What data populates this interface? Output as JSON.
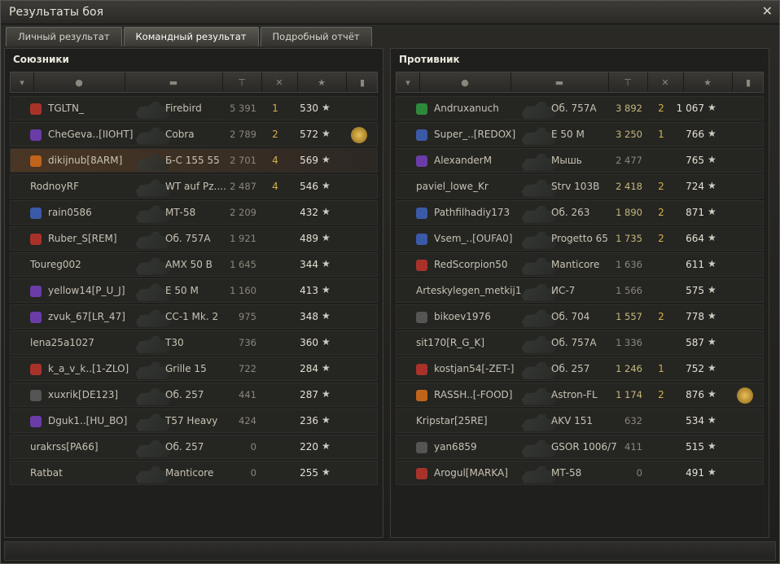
{
  "window": {
    "title": "Результаты боя"
  },
  "tabs": [
    {
      "label": "Личный результат",
      "active": false
    },
    {
      "label": "Командный результат",
      "active": true
    },
    {
      "label": "Подробный отчёт",
      "active": false
    }
  ],
  "allies": {
    "title": "Союзники",
    "rows": [
      {
        "name": "TGLTN_",
        "badge": "red",
        "tank": "Firebird",
        "damage": "5 391",
        "frags": "1",
        "xp": "530",
        "medal": false,
        "highlight": false
      },
      {
        "name": "CheGeva..[IIOHT]",
        "badge": "purple",
        "tank": "Cobra",
        "damage": "2 789",
        "frags": "2",
        "xp": "572",
        "medal": true,
        "highlight": false
      },
      {
        "name": "dikijnub[8ARM]",
        "badge": "orange",
        "tank": "Б-С 155 55",
        "damage": "2 701",
        "frags": "4",
        "xp": "569",
        "medal": false,
        "highlight": true
      },
      {
        "name": "RodnoyRF",
        "badge": "",
        "tank": "WT auf Pz....",
        "damage": "2 487",
        "frags": "4",
        "xp": "546",
        "medal": false,
        "highlight": false
      },
      {
        "name": "rain0586",
        "badge": "blue",
        "tank": "МТ-58",
        "damage": "2 209",
        "frags": "",
        "xp": "432",
        "medal": false,
        "highlight": false
      },
      {
        "name": "Ruber_S[REM]",
        "badge": "red",
        "tank": "Об. 757А",
        "damage": "1 921",
        "frags": "",
        "xp": "489",
        "medal": false,
        "highlight": false
      },
      {
        "name": "Toureg002",
        "badge": "",
        "tank": "AMX 50 B",
        "damage": "1 645",
        "frags": "",
        "xp": "344",
        "medal": false,
        "highlight": false
      },
      {
        "name": "yellow14[P_U_J]",
        "badge": "purple",
        "tank": "E 50 M",
        "damage": "1 160",
        "frags": "",
        "xp": "413",
        "medal": false,
        "highlight": false
      },
      {
        "name": "zvuk_67[LR_47]",
        "badge": "purple",
        "tank": "CC-1 Mk. 2",
        "damage": "975",
        "frags": "",
        "xp": "348",
        "medal": false,
        "highlight": false
      },
      {
        "name": "lena25a1027",
        "badge": "",
        "tank": "T30",
        "damage": "736",
        "frags": "",
        "xp": "360",
        "medal": false,
        "highlight": false
      },
      {
        "name": "k_a_v_k..[1-ZLO]",
        "badge": "red",
        "tank": "Grille 15",
        "damage": "722",
        "frags": "",
        "xp": "284",
        "medal": false,
        "highlight": false
      },
      {
        "name": "xuxrik[DE123]",
        "badge": "gray",
        "tank": "Об. 257",
        "damage": "441",
        "frags": "",
        "xp": "287",
        "medal": false,
        "highlight": false
      },
      {
        "name": "Dguk1..[HU_BO]",
        "badge": "purple",
        "tank": "T57 Heavy",
        "damage": "424",
        "frags": "",
        "xp": "236",
        "medal": false,
        "highlight": false
      },
      {
        "name": "urakrss[PA66]",
        "badge": "",
        "tank": "Об. 257",
        "damage": "0",
        "frags": "",
        "xp": "220",
        "medal": false,
        "highlight": false
      },
      {
        "name": "Ratbat",
        "badge": "",
        "tank": "Manticore",
        "damage": "0",
        "frags": "",
        "xp": "255",
        "medal": false,
        "highlight": false
      }
    ]
  },
  "enemies": {
    "title": "Противник",
    "rows": [
      {
        "name": "Andruxanuch",
        "badge": "green",
        "tank": "Об. 757А",
        "damage": "3 892",
        "frags": "2",
        "xp": "1 067",
        "medal": false
      },
      {
        "name": "Super_..[REDOX]",
        "badge": "blue",
        "tank": "E 50 M",
        "damage": "3 250",
        "frags": "1",
        "xp": "766",
        "medal": false
      },
      {
        "name": "AlexanderM",
        "badge": "purple",
        "tank": "Мышь",
        "damage": "2 477",
        "frags": "",
        "xp": "765",
        "medal": false
      },
      {
        "name": "paviel_lowe_Kr",
        "badge": "",
        "tank": "Strv 103B",
        "damage": "2 418",
        "frags": "2",
        "xp": "724",
        "medal": false
      },
      {
        "name": "Pathfilhadiy173",
        "badge": "blue",
        "tank": "Об. 263",
        "damage": "1 890",
        "frags": "2",
        "xp": "871",
        "medal": false
      },
      {
        "name": "Vsem_..[OUFA0]",
        "badge": "blue",
        "tank": "Progetto 65",
        "damage": "1 735",
        "frags": "2",
        "xp": "664",
        "medal": false
      },
      {
        "name": "RedScorpion50",
        "badge": "red",
        "tank": "Manticore",
        "damage": "1 636",
        "frags": "",
        "xp": "611",
        "medal": false
      },
      {
        "name": "Arteskylegen_metkij1",
        "badge": "",
        "tank": "ИС-7",
        "damage": "1 566",
        "frags": "",
        "xp": "575",
        "medal": false
      },
      {
        "name": "bikoev1976",
        "badge": "gray",
        "tank": "Об. 704",
        "damage": "1 557",
        "frags": "2",
        "xp": "778",
        "medal": false
      },
      {
        "name": "sit170[R_G_K]",
        "badge": "",
        "tank": "Об. 757А",
        "damage": "1 336",
        "frags": "",
        "xp": "587",
        "medal": false
      },
      {
        "name": "kostjan54[-ZET-]",
        "badge": "red",
        "tank": "Об. 257",
        "damage": "1 246",
        "frags": "1",
        "xp": "752",
        "medal": false
      },
      {
        "name": "RASSH..[-FOOD]",
        "badge": "orange",
        "tank": "Astron-FL",
        "damage": "1 174",
        "frags": "2",
        "xp": "876",
        "medal": true
      },
      {
        "name": "Kripstar[25RE]",
        "badge": "",
        "tank": "AKV 151",
        "damage": "632",
        "frags": "",
        "xp": "534",
        "medal": false
      },
      {
        "name": "yan6859",
        "badge": "gray",
        "tank": "GSOR 1006/7",
        "damage": "411",
        "frags": "",
        "xp": "515",
        "medal": false
      },
      {
        "name": "Arogul[MARKA]",
        "badge": "red",
        "tank": "МТ-58",
        "damage": "0",
        "frags": "",
        "xp": "491",
        "medal": false
      }
    ]
  },
  "icons": {
    "star": "★",
    "close": "✕"
  },
  "colors": {
    "frags": "#d4b04a",
    "highlight_row": "#4a3624",
    "medal": "#e8c05a"
  }
}
